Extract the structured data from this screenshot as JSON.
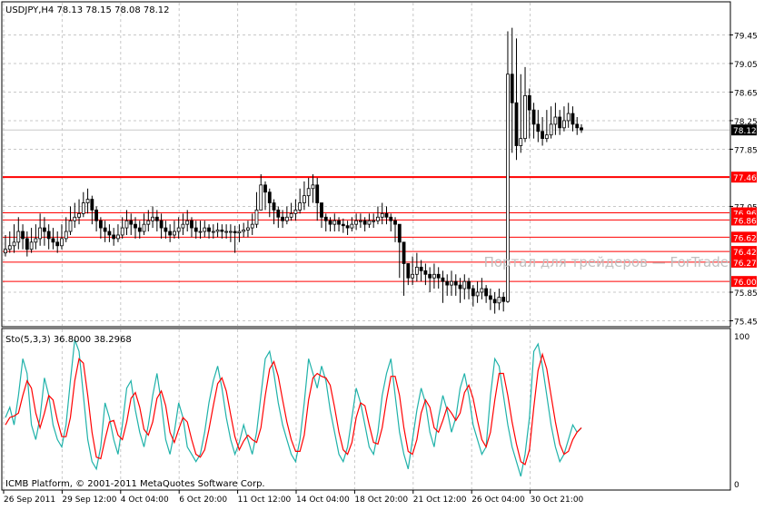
{
  "header": {
    "symbol_line": "USDJPY,H4  78.13 78.15 78.08 78.12",
    "stoch_line": "Sto(5,3,3) 36.8000 38.2968",
    "copyright": "ICMB Platform, © 2001-2011 MetaQuotes Software Corp.",
    "watermark": "Портал для трейдеров — ForTrade"
  },
  "colors": {
    "background": "#ffffff",
    "grid": "#c8c8c8",
    "candle": "#000000",
    "level_line": "#ff0000",
    "label_bg": "#ff0000",
    "current_label_bg": "#000000",
    "stoch_main": "#20b2aa",
    "stoch_signal": "#ff0000",
    "watermark": "#c0c0c0"
  },
  "chart_data": [
    {
      "type": "candlestick",
      "title": "USDJPY,H4",
      "x_tick_labels": [
        "26 Sep 2011",
        "29 Sep 12:00",
        "4 Oct 04:00",
        "6 Oct 20:00",
        "11 Oct 12:00",
        "14 Oct 04:00",
        "18 Oct 20:00",
        "21 Oct 12:00",
        "26 Oct 04:00",
        "30 Oct 21:00"
      ],
      "y_ticks": [
        79.45,
        79.05,
        78.65,
        78.25,
        77.85,
        77.05,
        75.85,
        75.45
      ],
      "y_tick_labels": [
        "79.45",
        "79.05",
        "78.65",
        "78.25",
        "77.85",
        "77.05",
        "75.85",
        "75.45"
      ],
      "ylim": [
        75.38,
        79.9
      ],
      "current_price": 78.12,
      "current_price_label": "78.12",
      "levels": [
        77.46,
        76.96,
        76.86,
        76.62,
        76.42,
        76.27,
        76.0
      ],
      "level_labels": [
        "77.46",
        "76.96",
        "76.86",
        "76.62",
        "76.42",
        "76.27",
        "76.00"
      ],
      "closes": [
        76.45,
        76.5,
        76.55,
        76.7,
        76.6,
        76.45,
        76.55,
        76.6,
        76.75,
        76.7,
        76.6,
        76.55,
        76.5,
        76.6,
        76.7,
        76.85,
        76.9,
        76.95,
        77.1,
        77.15,
        77.0,
        76.85,
        76.75,
        76.7,
        76.65,
        76.6,
        76.65,
        76.75,
        76.85,
        76.8,
        76.75,
        76.7,
        76.8,
        76.85,
        76.9,
        76.85,
        76.75,
        76.7,
        76.65,
        76.7,
        76.75,
        76.8,
        76.85,
        76.75,
        76.7,
        76.7,
        76.75,
        76.7,
        76.7,
        76.72,
        76.7,
        76.7,
        76.7,
        76.68,
        76.7,
        76.72,
        76.75,
        76.8,
        77.0,
        77.35,
        77.25,
        77.1,
        77.0,
        76.9,
        76.85,
        76.9,
        76.95,
        77.0,
        77.1,
        77.2,
        77.3,
        77.35,
        77.1,
        76.9,
        76.85,
        76.8,
        76.85,
        76.8,
        76.78,
        76.75,
        76.8,
        76.85,
        76.85,
        76.8,
        76.85,
        76.85,
        76.9,
        76.95,
        76.9,
        76.85,
        76.8,
        76.55,
        76.25,
        76.05,
        76.1,
        76.2,
        76.15,
        76.1,
        76.05,
        76.1,
        76.05,
        76.0,
        75.95,
        76.0,
        75.95,
        75.9,
        76.0,
        75.9,
        75.8,
        75.85,
        75.9,
        75.8,
        75.75,
        75.7,
        75.78,
        75.72,
        78.9,
        78.5,
        77.9,
        78.0,
        78.6,
        78.4,
        78.2,
        78.1,
        78.0,
        78.05,
        78.2,
        78.3,
        78.15,
        78.25,
        78.35,
        78.2,
        78.15,
        78.12
      ],
      "lows": [
        76.35,
        76.4,
        76.4,
        76.45,
        76.45,
        76.35,
        76.4,
        76.45,
        76.5,
        76.5,
        76.45,
        76.45,
        76.4,
        76.45,
        76.55,
        76.65,
        76.75,
        76.8,
        76.9,
        76.95,
        76.8,
        76.7,
        76.6,
        76.55,
        76.55,
        76.5,
        76.55,
        76.6,
        76.65,
        76.65,
        76.6,
        76.6,
        76.65,
        76.7,
        76.75,
        76.7,
        76.6,
        76.6,
        76.55,
        76.6,
        76.6,
        76.65,
        76.7,
        76.62,
        76.6,
        76.6,
        76.62,
        76.6,
        76.6,
        76.62,
        76.6,
        76.6,
        76.55,
        76.4,
        76.55,
        76.62,
        76.62,
        76.65,
        76.75,
        77.0,
        77.0,
        76.9,
        76.8,
        76.75,
        76.75,
        76.8,
        76.85,
        76.85,
        76.95,
        77.0,
        77.05,
        77.1,
        76.85,
        76.75,
        76.7,
        76.7,
        76.7,
        76.7,
        76.68,
        76.65,
        76.7,
        76.72,
        76.75,
        76.7,
        76.75,
        76.75,
        76.8,
        76.8,
        76.8,
        76.7,
        76.55,
        76.05,
        75.8,
        75.95,
        75.95,
        76.0,
        76.0,
        75.95,
        75.85,
        75.9,
        75.9,
        75.7,
        75.8,
        75.8,
        75.8,
        75.7,
        75.75,
        75.75,
        75.65,
        75.7,
        75.75,
        75.7,
        75.6,
        75.55,
        75.6,
        75.58,
        75.7,
        77.8,
        77.7,
        77.8,
        77.95,
        78.0,
        78.0,
        77.95,
        77.9,
        77.95,
        78.0,
        78.05,
        78.05,
        78.1,
        78.15,
        78.1,
        78.05,
        78.08
      ],
      "highs": [
        76.65,
        76.7,
        76.8,
        76.9,
        76.8,
        76.7,
        76.75,
        76.8,
        76.95,
        76.9,
        76.8,
        76.75,
        76.7,
        76.8,
        76.9,
        77.05,
        77.1,
        77.15,
        77.25,
        77.3,
        77.2,
        77.05,
        76.9,
        76.85,
        76.8,
        76.75,
        76.8,
        76.9,
        77.0,
        76.95,
        76.9,
        76.85,
        76.95,
        77.0,
        77.05,
        77.0,
        76.95,
        76.85,
        76.8,
        76.85,
        76.9,
        76.95,
        77.0,
        76.9,
        76.85,
        76.85,
        76.85,
        76.8,
        76.8,
        76.82,
        76.8,
        76.8,
        76.8,
        76.78,
        76.8,
        76.82,
        76.85,
        76.95,
        77.25,
        77.5,
        77.4,
        77.3,
        77.15,
        77.05,
        77.0,
        77.05,
        77.1,
        77.15,
        77.3,
        77.4,
        77.45,
        77.5,
        77.45,
        77.05,
        76.95,
        76.9,
        76.95,
        76.9,
        76.88,
        76.85,
        76.9,
        76.95,
        76.95,
        76.9,
        76.95,
        76.95,
        77.05,
        77.1,
        77.05,
        76.95,
        76.9,
        76.7,
        76.5,
        76.25,
        76.35,
        76.4,
        76.3,
        76.25,
        76.2,
        76.25,
        76.2,
        76.15,
        76.1,
        76.15,
        76.1,
        76.05,
        76.1,
        76.05,
        75.95,
        76.0,
        76.05,
        75.95,
        75.9,
        75.85,
        75.9,
        75.85,
        79.5,
        79.55,
        79.4,
        78.9,
        79.0,
        78.7,
        78.5,
        78.4,
        78.3,
        78.4,
        78.45,
        78.5,
        78.4,
        78.45,
        78.5,
        78.45,
        78.3,
        78.2
      ]
    },
    {
      "type": "line",
      "title": "Sto(5,3,3)",
      "ylim": [
        0,
        100
      ],
      "y_tick_labels": [
        "100",
        "0"
      ],
      "series": [
        {
          "name": "Sto(5,3,3) 36.8000",
          "role": "main",
          "values": [
            45,
            52,
            40,
            60,
            85,
            75,
            40,
            30,
            45,
            72,
            60,
            40,
            30,
            25,
            40,
            70,
            98,
            90,
            60,
            30,
            15,
            10,
            25,
            55,
            45,
            30,
            20,
            40,
            65,
            70,
            50,
            35,
            25,
            40,
            60,
            75,
            55,
            30,
            20,
            35,
            55,
            45,
            25,
            20,
            15,
            20,
            35,
            55,
            70,
            80,
            65,
            45,
            30,
            20,
            28,
            40,
            30,
            20,
            35,
            60,
            85,
            90,
            75,
            55,
            40,
            30,
            20,
            15,
            30,
            55,
            85,
            75,
            65,
            80,
            70,
            50,
            35,
            20,
            15,
            25,
            45,
            65,
            55,
            40,
            25,
            20,
            35,
            60,
            75,
            85,
            60,
            35,
            20,
            10,
            30,
            50,
            65,
            55,
            35,
            25,
            45,
            60,
            50,
            35,
            45,
            65,
            75,
            60,
            40,
            30,
            20,
            25,
            60,
            85,
            80,
            60,
            40,
            25,
            15,
            5,
            20,
            45,
            90,
            95,
            80,
            60,
            40,
            25,
            15,
            20,
            30,
            40,
            35,
            38
          ]
        },
        {
          "name": "38.2968",
          "role": "signal",
          "values": [
            40,
            45,
            46,
            48,
            60,
            70,
            65,
            48,
            38,
            48,
            60,
            57,
            43,
            32,
            32,
            45,
            70,
            85,
            82,
            60,
            35,
            18,
            17,
            30,
            42,
            43,
            33,
            30,
            42,
            58,
            62,
            52,
            37,
            33,
            42,
            58,
            63,
            53,
            35,
            28,
            37,
            45,
            42,
            30,
            20,
            18,
            23,
            37,
            53,
            68,
            72,
            63,
            47,
            32,
            23,
            29,
            33,
            30,
            28,
            38,
            60,
            78,
            83,
            73,
            57,
            42,
            30,
            22,
            22,
            33,
            57,
            72,
            75,
            73,
            72,
            67,
            52,
            35,
            23,
            20,
            28,
            45,
            55,
            53,
            40,
            28,
            27,
            38,
            57,
            73,
            73,
            60,
            38,
            22,
            20,
            30,
            48,
            57,
            52,
            38,
            35,
            43,
            52,
            48,
            43,
            48,
            62,
            67,
            58,
            43,
            30,
            25,
            35,
            57,
            75,
            75,
            60,
            42,
            27,
            15,
            13,
            23,
            52,
            77,
            88,
            78,
            60,
            42,
            27,
            20,
            22,
            30,
            35,
            38
          ]
        }
      ]
    }
  ]
}
